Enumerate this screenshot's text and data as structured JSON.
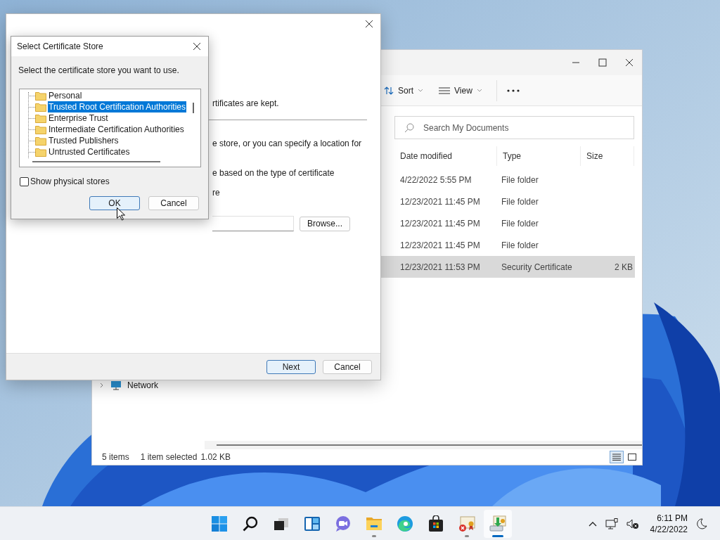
{
  "explorer": {
    "toolbar": [
      {
        "label": "Sort",
        "kind": "sort"
      },
      {
        "label": "View",
        "kind": "view"
      }
    ],
    "search": {
      "placeholder": "Search My Documents"
    },
    "columns": [
      "Date modified",
      "Type",
      "Size"
    ],
    "rows": [
      {
        "date": "4/22/2022 5:55 PM",
        "type": "File folder",
        "selected": false
      },
      {
        "date": "12/23/2021 11:45 PM",
        "type": "File folder",
        "selected": false
      },
      {
        "date": "12/23/2021 11:45 PM",
        "type": "File folder",
        "selected": false
      },
      {
        "date": "12/23/2021 11:45 PM",
        "type": "File folder",
        "selected": false
      },
      {
        "date": "12/23/2021 11:53 PM",
        "type": "Security Certificate",
        "size": "2 KB",
        "selected": true
      }
    ],
    "nav": [
      {
        "label": "Network",
        "expanded": false
      }
    ],
    "status": {
      "count": "5 items",
      "selection": "1 item selected",
      "size": "1.02 KB"
    },
    "views": [
      {
        "kind": "details",
        "selected": true
      },
      {
        "kind": "preview",
        "selected": false
      }
    ]
  },
  "wizard": {
    "intro": "rtificates are kept.",
    "body": [
      "e store, or you can specify a location for",
      "e based on the type of certificate",
      "re"
    ],
    "browse_button": "Browse...",
    "buttons": [
      {
        "label": "Next",
        "default": true
      },
      {
        "label": "Cancel",
        "default": false
      }
    ]
  },
  "dialog": {
    "title": "Select Certificate Store",
    "prompt": "Select the certificate store you want to use.",
    "stores": [
      {
        "label": "Personal",
        "selected": false
      },
      {
        "label": "Trusted Root Certification Authorities",
        "selected": true
      },
      {
        "label": "Enterprise Trust",
        "selected": false
      },
      {
        "label": "Intermediate Certification Authorities",
        "selected": false
      },
      {
        "label": "Trusted Publishers",
        "selected": false
      },
      {
        "label": "Untrusted Certificates",
        "selected": false
      }
    ],
    "show_physical_stores": {
      "label": "Show physical stores",
      "checked": false
    },
    "buttons": [
      {
        "label": "OK",
        "default": true
      },
      {
        "label": "Cancel",
        "default": false
      }
    ]
  },
  "taskbar": {
    "apps": [
      {
        "kind": "start",
        "running": false,
        "active": false
      },
      {
        "kind": "search",
        "running": false,
        "active": false
      },
      {
        "kind": "task-view",
        "running": false,
        "active": false
      },
      {
        "kind": "widgets",
        "running": false,
        "active": false
      },
      {
        "kind": "chat",
        "running": false,
        "active": false
      },
      {
        "kind": "explorer",
        "running": true,
        "active": false
      },
      {
        "kind": "edge",
        "running": false,
        "active": false
      },
      {
        "kind": "store",
        "running": false,
        "active": false
      },
      {
        "kind": "cert-error",
        "running": true,
        "active": false
      },
      {
        "kind": "cert-import",
        "running": true,
        "active": true
      }
    ],
    "clock": {
      "time": "6:11 PM",
      "date": "4/22/2022"
    }
  }
}
